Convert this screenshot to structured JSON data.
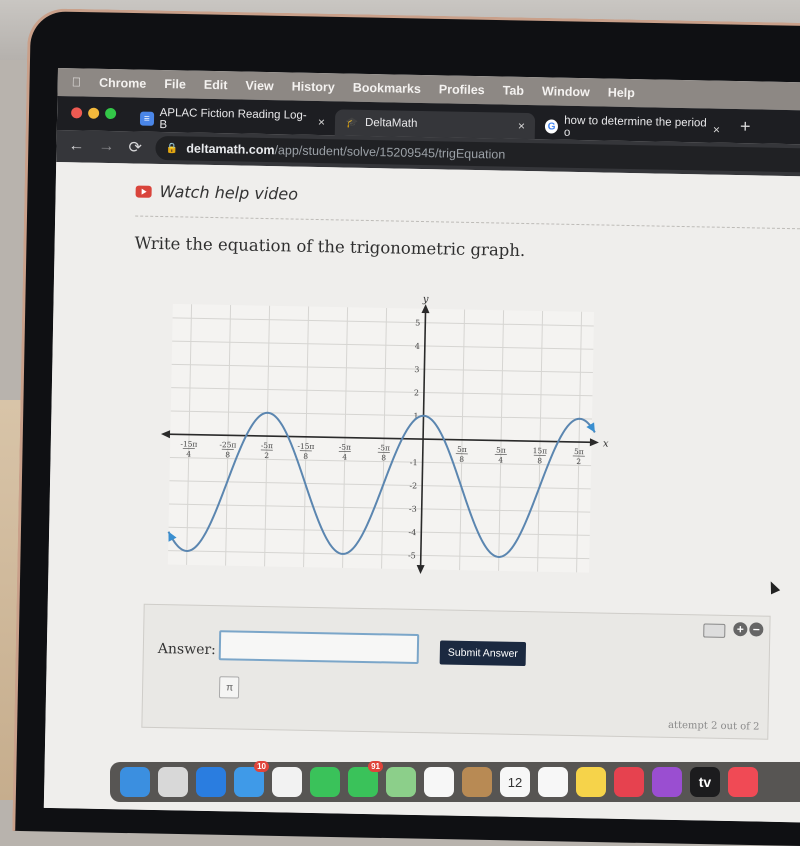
{
  "menubar": {
    "apple_icon": "apple-icon",
    "items": [
      "Chrome",
      "File",
      "Edit",
      "View",
      "History",
      "Bookmarks",
      "Profiles",
      "Tab",
      "Window",
      "Help"
    ]
  },
  "tabs": [
    {
      "label": "APLAC Fiction Reading Log- B",
      "icon": "google-docs-icon",
      "active": false
    },
    {
      "label": "DeltaMath",
      "icon": "deltamath-icon",
      "active": true
    },
    {
      "label": "how to determine the period o",
      "icon": "google-icon",
      "active": false
    }
  ],
  "new_tab_label": "+",
  "close_label": "×",
  "address": {
    "host": "deltamath.com",
    "path": "/app/student/solve/15209545/trigEquation"
  },
  "page": {
    "help_link": "Watch help video",
    "question": "Write the equation of the trigonometric graph.",
    "answer_label": "Answer:",
    "answer_value": "",
    "submit_label": "Submit Answer",
    "pi_button": "π",
    "attempt_text": "attempt 2 out of 2",
    "zoom_in": "+",
    "zoom_out": "−"
  },
  "chart_data": {
    "type": "line",
    "title": "",
    "xlabel": "x",
    "ylabel": "y",
    "function": "y = 3cos(4x/5) - 2",
    "amplitude": 3,
    "midline": -2,
    "period_in_pi": 2.5,
    "x_tick_labels": [
      "-15π/4",
      "-25π/8",
      "-5π/2",
      "-15π/8",
      "-5π/4",
      "-5π/8",
      "5π/8",
      "5π/4",
      "15π/8",
      "5π/2"
    ],
    "x_tick_values_in_pi": [
      -3.75,
      -3.125,
      -2.5,
      -1.875,
      -1.25,
      -0.625,
      0.625,
      1.25,
      1.875,
      2.5
    ],
    "y_tick_labels": [
      "5",
      "4",
      "3",
      "2",
      "1",
      "-1",
      "-2",
      "-3",
      "-4",
      "-5"
    ],
    "y_tick_values": [
      5,
      4,
      3,
      2,
      1,
      -1,
      -2,
      -3,
      -4,
      -5
    ],
    "xlim_in_pi": [
      -4.2,
      2.85
    ],
    "ylim": [
      -5.8,
      5.8
    ],
    "key_points": [
      {
        "x_in_pi": -3.75,
        "y": -5
      },
      {
        "x_in_pi": -2.5,
        "y": 1
      },
      {
        "x_in_pi": -1.25,
        "y": -5
      },
      {
        "x_in_pi": 0,
        "y": 1
      },
      {
        "x_in_pi": 1.25,
        "y": -5
      },
      {
        "x_in_pi": 2.5,
        "y": 1
      }
    ],
    "curve_domain_in_pi": [
      -4.05,
      2.75
    ],
    "grid": true,
    "curve_color": "#5b86b0",
    "arrow_color": "#3a8fd0"
  },
  "dock": {
    "apps": [
      {
        "name": "finder",
        "color": "#3b8fe0",
        "badge": null
      },
      {
        "name": "launchpad",
        "color": "#d8d8d8",
        "badge": null
      },
      {
        "name": "safari",
        "color": "#2a7de0",
        "badge": null
      },
      {
        "name": "mail",
        "color": "#3f9ae8",
        "badge": "10"
      },
      {
        "name": "chrome",
        "color": "#f2f2f2",
        "badge": null
      },
      {
        "name": "facetime",
        "color": "#3ac25a",
        "badge": null
      },
      {
        "name": "messages",
        "color": "#3ac25a",
        "badge": "91"
      },
      {
        "name": "maps",
        "color": "#8ccf8a",
        "badge": null
      },
      {
        "name": "photos",
        "color": "#f7f7f7",
        "badge": null
      },
      {
        "name": "contacts",
        "color": "#b88a54",
        "badge": null
      },
      {
        "name": "calendar",
        "color": "#f7f7f7",
        "badge": null,
        "month": "FEB",
        "day": "12"
      },
      {
        "name": "reminders",
        "color": "#f7f7f7",
        "badge": null
      },
      {
        "name": "notes",
        "color": "#f6d34a",
        "badge": null
      },
      {
        "name": "music",
        "color": "#e6424f",
        "badge": null
      },
      {
        "name": "podcasts",
        "color": "#9a4ed1",
        "badge": null
      },
      {
        "name": "apple-tv",
        "color": "#1c1c1e",
        "badge": null,
        "label": "tv"
      },
      {
        "name": "news",
        "color": "#f04a55",
        "badge": null
      }
    ]
  }
}
